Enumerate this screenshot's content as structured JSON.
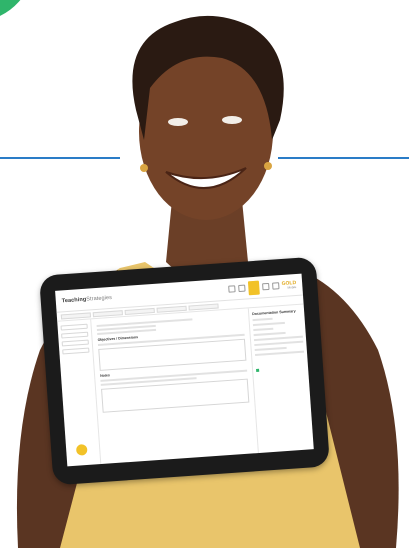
{
  "tablet": {
    "brand": "Teaching",
    "brand_suffix": "Strategies",
    "badge": "GOLD",
    "badge_sub": "Mobile",
    "summary_title": "Documentation Summary",
    "notes_title": "Notes",
    "objectives_title": "Objectives / Dimensions"
  }
}
